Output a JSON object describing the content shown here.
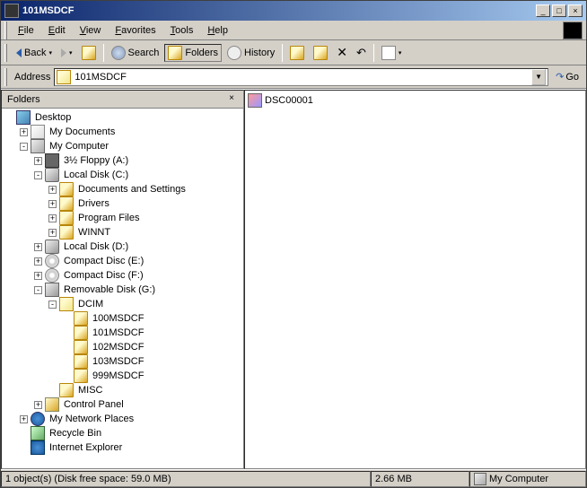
{
  "title": "101MSDCF",
  "menu": [
    "File",
    "Edit",
    "View",
    "Favorites",
    "Tools",
    "Help"
  ],
  "toolbar": {
    "back": "Back",
    "search": "Search",
    "folders": "Folders",
    "history": "History"
  },
  "address": {
    "label": "Address",
    "value": "101MSDCF",
    "go": "Go"
  },
  "folders_pane": {
    "title": "Folders"
  },
  "tree": [
    {
      "indent": 0,
      "exp": null,
      "icon": "i-desktop",
      "label": "Desktop"
    },
    {
      "indent": 1,
      "exp": "+",
      "icon": "i-mydocs",
      "label": "My Documents"
    },
    {
      "indent": 1,
      "exp": "-",
      "icon": "i-computer",
      "label": "My Computer"
    },
    {
      "indent": 2,
      "exp": "+",
      "icon": "i-floppy",
      "label": "3½ Floppy (A:)"
    },
    {
      "indent": 2,
      "exp": "-",
      "icon": "i-drive",
      "label": "Local Disk (C:)"
    },
    {
      "indent": 3,
      "exp": "+",
      "icon": "i-folder",
      "label": "Documents and Settings"
    },
    {
      "indent": 3,
      "exp": "+",
      "icon": "i-folder",
      "label": "Drivers"
    },
    {
      "indent": 3,
      "exp": "+",
      "icon": "i-folder",
      "label": "Program Files"
    },
    {
      "indent": 3,
      "exp": "+",
      "icon": "i-folder",
      "label": "WINNT"
    },
    {
      "indent": 2,
      "exp": "+",
      "icon": "i-drive",
      "label": "Local Disk (D:)"
    },
    {
      "indent": 2,
      "exp": "+",
      "icon": "i-cd",
      "label": "Compact Disc (E:)"
    },
    {
      "indent": 2,
      "exp": "+",
      "icon": "i-cd",
      "label": "Compact Disc (F:)"
    },
    {
      "indent": 2,
      "exp": "-",
      "icon": "i-removable",
      "label": "Removable Disk (G:)"
    },
    {
      "indent": 3,
      "exp": "-",
      "icon": "i-folder-open",
      "label": "DCIM"
    },
    {
      "indent": 4,
      "exp": null,
      "icon": "i-folder",
      "label": "100MSDCF"
    },
    {
      "indent": 4,
      "exp": null,
      "icon": "i-folder",
      "label": "101MSDCF"
    },
    {
      "indent": 4,
      "exp": null,
      "icon": "i-folder",
      "label": "102MSDCF"
    },
    {
      "indent": 4,
      "exp": null,
      "icon": "i-folder",
      "label": "103MSDCF"
    },
    {
      "indent": 4,
      "exp": null,
      "icon": "i-folder",
      "label": "999MSDCF"
    },
    {
      "indent": 3,
      "exp": null,
      "icon": "i-folder",
      "label": "MISC"
    },
    {
      "indent": 2,
      "exp": "+",
      "icon": "i-cpanel",
      "label": "Control Panel"
    },
    {
      "indent": 1,
      "exp": "+",
      "icon": "i-network",
      "label": "My Network Places"
    },
    {
      "indent": 1,
      "exp": null,
      "icon": "i-recycle",
      "label": "Recycle Bin"
    },
    {
      "indent": 1,
      "exp": null,
      "icon": "i-ie",
      "label": "Internet Explorer"
    }
  ],
  "content": {
    "files": [
      "DSC00001"
    ]
  },
  "status": {
    "objects": "1 object(s) (Disk free space: 59.0 MB)",
    "size": "2.66 MB",
    "location": "My Computer"
  }
}
